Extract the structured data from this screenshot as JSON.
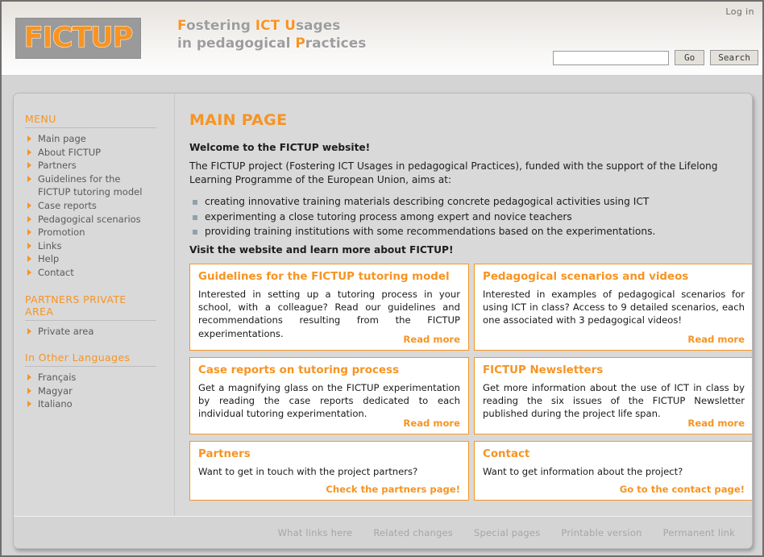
{
  "header": {
    "login_label": "Log in",
    "logo_text": "FICTUP",
    "tagline_line1_pre": "F",
    "tagline_line1_a": "ostering ",
    "tagline_line1_ict": "ICT",
    "tagline_line1_b": " ",
    "tagline_line1_u": "U",
    "tagline_line1_c": "sages",
    "tagline_line2_a": "in pedagogical ",
    "tagline_line2_p": "P",
    "tagline_line2_b": "ractices",
    "accent_color": "#f79422",
    "logo_bg_color": "#9a9a9a"
  },
  "search": {
    "value": "",
    "placeholder": "",
    "go_label": "Go",
    "search_label": "Search"
  },
  "sidebar": {
    "menu_heading": "MENU",
    "menu_items": [
      {
        "label": "Main page",
        "label2": ""
      },
      {
        "label": "About FICTUP",
        "label2": ""
      },
      {
        "label": "Partners",
        "label2": ""
      },
      {
        "label": "Guidelines for the",
        "label2": "FICTUP tutoring model"
      },
      {
        "label": "Case reports",
        "label2": ""
      },
      {
        "label": "Pedagogical scenarios",
        "label2": ""
      },
      {
        "label": "Promotion",
        "label2": ""
      },
      {
        "label": "Links",
        "label2": ""
      },
      {
        "label": "Help",
        "label2": ""
      },
      {
        "label": "Contact",
        "label2": ""
      }
    ],
    "private_heading": "PARTNERS PRIVATE AREA",
    "private_items": [
      {
        "label": "Private area",
        "label2": ""
      }
    ],
    "languages_heading": "In Other Languages",
    "language_items": [
      {
        "label": "Français",
        "label2": ""
      },
      {
        "label": "Magyar",
        "label2": ""
      },
      {
        "label": "Italiano",
        "label2": ""
      }
    ]
  },
  "main": {
    "title": "MAIN PAGE",
    "welcome": "Welcome to the FICTUP website!",
    "intro": "The FICTUP project (Fostering ICT Usages in pedagogical Practices), funded with the support of the Lifelong Learning Programme of the European Union, aims at:",
    "aims": [
      "creating innovative training materials describing concrete pedagogical activities using ICT",
      "experimenting a close tutoring process among expert and novice teachers",
      "providing training institutions with some recommendations based on the experimentations."
    ],
    "visit": "Visit the website and learn more about FICTUP!",
    "boxes": [
      {
        "title": "Guidelines for the FICTUP tutoring model",
        "body": "Interested in setting up a tutoring process in your school, with a colleague? Read our guidelines and recommendations resulting from the FICTUP experimentations.",
        "link": "Read more"
      },
      {
        "title": "Pedagogical scenarios and videos",
        "body": "Interested in examples of pedagogical scenarios for using ICT in class? Access to 9 detailed scenarios, each one associated with 3 pedagogical videos!",
        "link": "Read more"
      },
      {
        "title": "Case reports on tutoring process",
        "body": "Get a magnifying glass on the FICTUP experimentation by reading the case reports dedicated to each individual tutoring experimentation.",
        "link": "Read more"
      },
      {
        "title": "FICTUP Newsletters",
        "body": "Get more information about the use of ICT in class by reading the six issues of the FICTUP Newsletter published during the project life span.",
        "link": "Read more"
      },
      {
        "title": "Partners",
        "body": "Want to get in touch with the project partners?",
        "link": "Check the partners page!"
      },
      {
        "title": "Contact",
        "body": "Want to get information about the project?",
        "link": "Go to the contact page!"
      }
    ]
  },
  "footer": {
    "links": [
      "What links here",
      "Related changes",
      "Special pages",
      "Printable version",
      "Permanent link"
    ]
  }
}
